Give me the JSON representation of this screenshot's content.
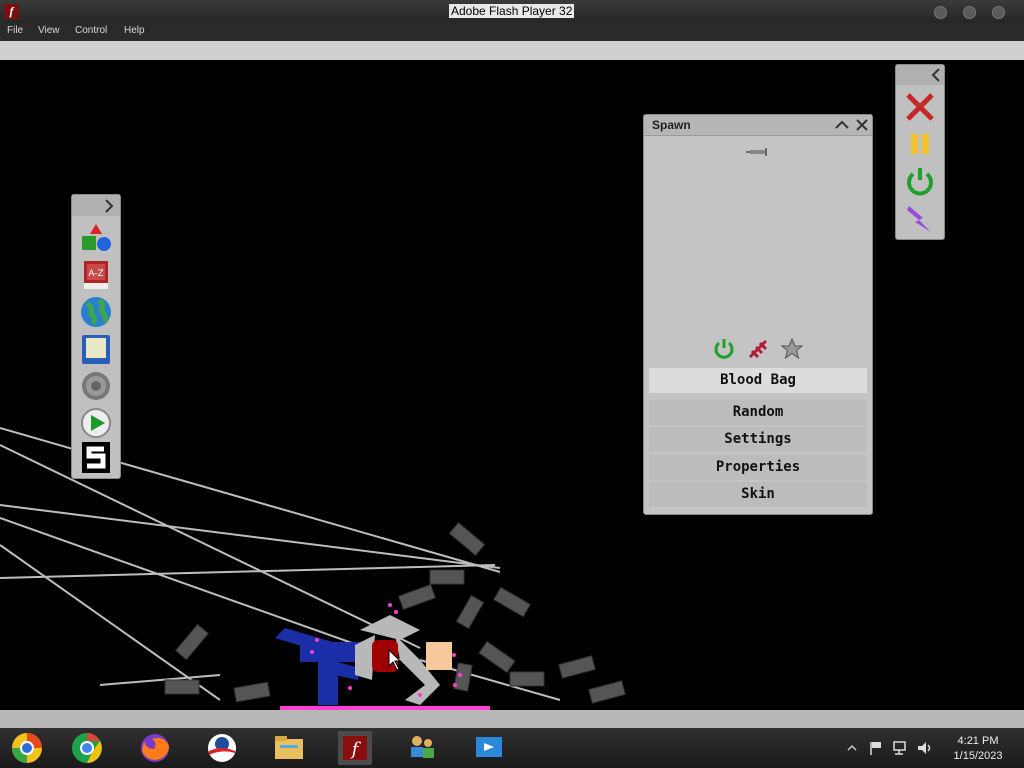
{
  "window": {
    "title": "Adobe Flash Player 32"
  },
  "menu": {
    "items": [
      "File",
      "View",
      "Control",
      "Help"
    ]
  },
  "spawn_panel": {
    "title": "Spawn",
    "buttons": [
      "Blood Bag",
      "Random",
      "Settings",
      "Properties",
      "Skin"
    ],
    "selected": "Blood Bag"
  },
  "left_toolbar": {
    "icons": [
      "shapes-icon",
      "a-z-book-icon",
      "globe-icon",
      "save-disk-icon",
      "gear-icon",
      "play-icon",
      "s-logo-icon"
    ]
  },
  "right_toolbar": {
    "icons": [
      "close-x-icon",
      "pause-icon",
      "power-icon",
      "lightning-icon"
    ]
  },
  "taskbar": {
    "apps": [
      "chrome-canary-icon",
      "chrome-icon",
      "firefox-icon",
      "obama-logo-icon",
      "file-explorer-icon",
      "flash-player-icon",
      "network-people-icon",
      "remote-desktop-icon"
    ],
    "active_app": "flash-player-icon",
    "time": "4:21 PM",
    "date": "1/15/2023"
  },
  "colors": {
    "panel": "#c0c0c0",
    "background": "#000000",
    "ragdoll_blue": "#1a2ea8",
    "blood_red": "#a00000"
  }
}
